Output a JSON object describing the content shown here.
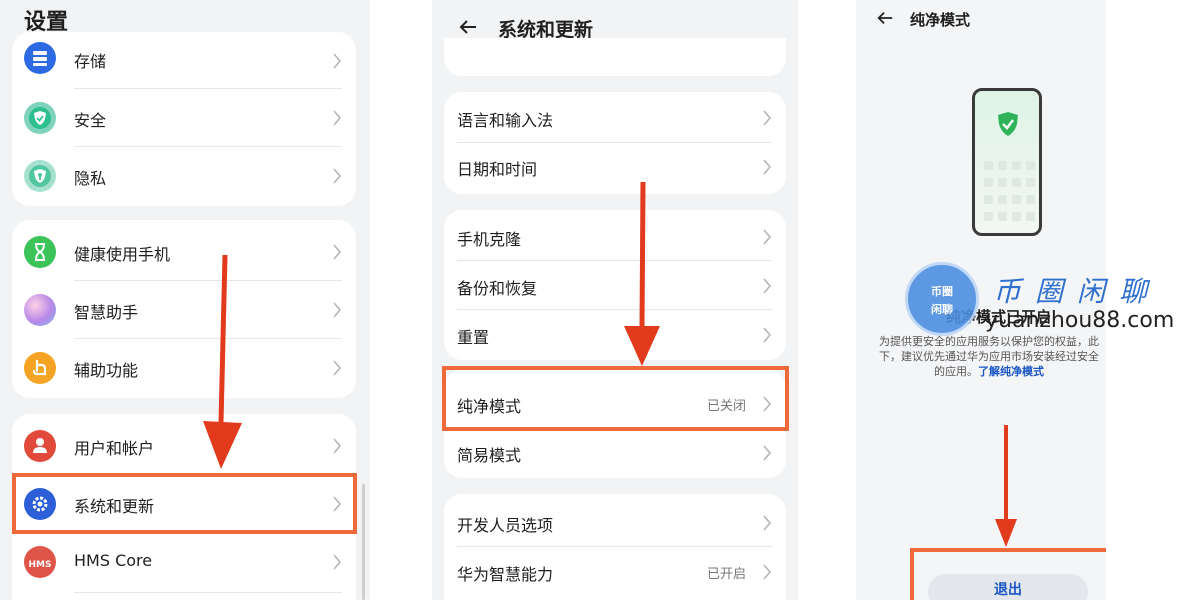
{
  "panel1": {
    "title": "设置",
    "group1": [
      {
        "label": "存储",
        "icon": "storage-icon",
        "color": "#2d6be4"
      },
      {
        "label": "安全",
        "icon": "shield-icon",
        "color": "#2fbf8f"
      },
      {
        "label": "隐私",
        "icon": "privacy-icon",
        "color": "#2fbf8f"
      }
    ],
    "group2": [
      {
        "label": "健康使用手机",
        "icon": "hourglass-icon",
        "color": "#3cc45a"
      },
      {
        "label": "智慧助手",
        "icon": "assistant-icon",
        "color": "#b889e8"
      },
      {
        "label": "辅助功能",
        "icon": "accessibility-icon",
        "color": "#f5a323"
      }
    ],
    "group3": [
      {
        "label": "用户和帐户",
        "icon": "user-icon",
        "color": "#e24a3b"
      },
      {
        "label": "系统和更新",
        "icon": "gear-icon",
        "color": "#2d5fd8"
      },
      {
        "label": "HMS Core",
        "icon": "hms-icon",
        "color": "#e0554a",
        "badge": "HMS"
      }
    ]
  },
  "panel2": {
    "title": "系统和更新",
    "group1": [
      {
        "label": "语言和输入法"
      },
      {
        "label": "日期和时间"
      }
    ],
    "group2": [
      {
        "label": "手机克隆"
      },
      {
        "label": "备份和恢复"
      },
      {
        "label": "重置"
      }
    ],
    "group3": [
      {
        "label": "纯净模式",
        "value": "已关闭"
      },
      {
        "label": "简易模式"
      }
    ],
    "group4": [
      {
        "label": "开发人员选项"
      },
      {
        "label": "华为智慧能力",
        "value": "已开启"
      }
    ]
  },
  "panel3": {
    "title": "纯净模式",
    "status": "纯净模式已开启",
    "description": "为提供更安全的应用服务以保护您的权益，此下，建议优先通过华为应用市场安装经过安全的应用。",
    "learn_more": "了解纯净模式",
    "exit_label": "退出"
  },
  "watermark": {
    "circle_top": "币圈",
    "circle_bottom": "闲聊",
    "brand": "币圈闲聊",
    "url": "yuanzhou88.com"
  },
  "colors": {
    "highlight": "#ef6a3a",
    "arrow": "#e23a1c",
    "link": "#1a56c6"
  }
}
